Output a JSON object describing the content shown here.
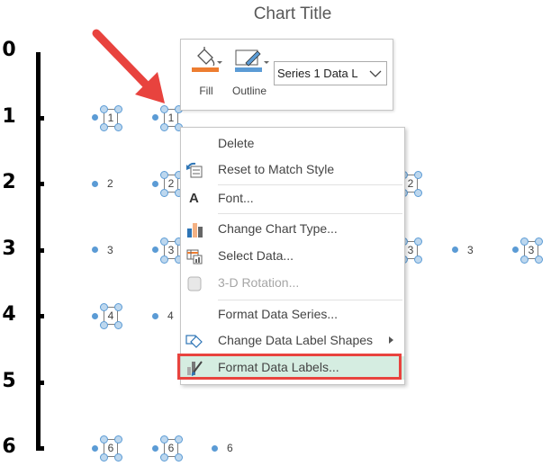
{
  "chart": {
    "title": "Chart Title",
    "axis_labels": [
      "0",
      "1",
      "2",
      "3",
      "4",
      "5",
      "6"
    ],
    "points": [
      {
        "row": 1,
        "col": 0,
        "label": "1",
        "selected": true
      },
      {
        "row": 1,
        "col": 1,
        "label": "1",
        "selected": true
      },
      {
        "row": 2,
        "col": 0,
        "label": "2",
        "selected": false
      },
      {
        "row": 2,
        "col": 1,
        "label": "2",
        "selected": true
      },
      {
        "row": 2,
        "col": 4,
        "label": "2",
        "selected": true
      },
      {
        "row": 3,
        "col": 0,
        "label": "3",
        "selected": false
      },
      {
        "row": 3,
        "col": 1,
        "label": "3",
        "selected": true
      },
      {
        "row": 3,
        "col": 4,
        "label": "3",
        "selected": true
      },
      {
        "row": 3,
        "col": 5,
        "label": "3",
        "selected": false
      },
      {
        "row": 3,
        "col": 6,
        "label": "3",
        "selected": true
      },
      {
        "row": 4,
        "col": 0,
        "label": "4",
        "selected": true
      },
      {
        "row": 4,
        "col": 1,
        "label": "4",
        "selected": false
      },
      {
        "row": 6,
        "col": 0,
        "label": "6",
        "selected": true
      },
      {
        "row": 6,
        "col": 1,
        "label": "6",
        "selected": true
      },
      {
        "row": 6,
        "col": 2,
        "label": "6",
        "selected": false
      }
    ],
    "colors": {
      "marker": "#5b9bd5",
      "arrow": "#e8433e"
    }
  },
  "mini_toolbar": {
    "fill_label": "Fill",
    "outline_label": "Outline",
    "fill_color": "#ed7d31",
    "outline_color": "#5b9bd5",
    "series_select_value": "Series 1 Data L"
  },
  "context_menu": {
    "items": [
      {
        "label": "Delete",
        "icon": "none",
        "disabled": false
      },
      {
        "label": "Reset to Match Style",
        "icon": "reset-style-icon",
        "disabled": false
      },
      {
        "label": "Font...",
        "icon": "font-icon",
        "disabled": false
      },
      {
        "label": "Change Chart Type...",
        "icon": "chart-type-icon",
        "disabled": false
      },
      {
        "label": "Select Data...",
        "icon": "select-data-icon",
        "disabled": false
      },
      {
        "label": "3-D Rotation...",
        "icon": "rotation-3d-icon",
        "disabled": true
      },
      {
        "label": "Format Data Series...",
        "icon": "none",
        "disabled": false
      },
      {
        "label": "Change Data Label Shapes",
        "icon": "label-shapes-icon",
        "disabled": false,
        "submenu": true
      },
      {
        "label": "Format Data Labels...",
        "icon": "format-labels-icon",
        "disabled": false,
        "highlighted": true
      }
    ]
  }
}
